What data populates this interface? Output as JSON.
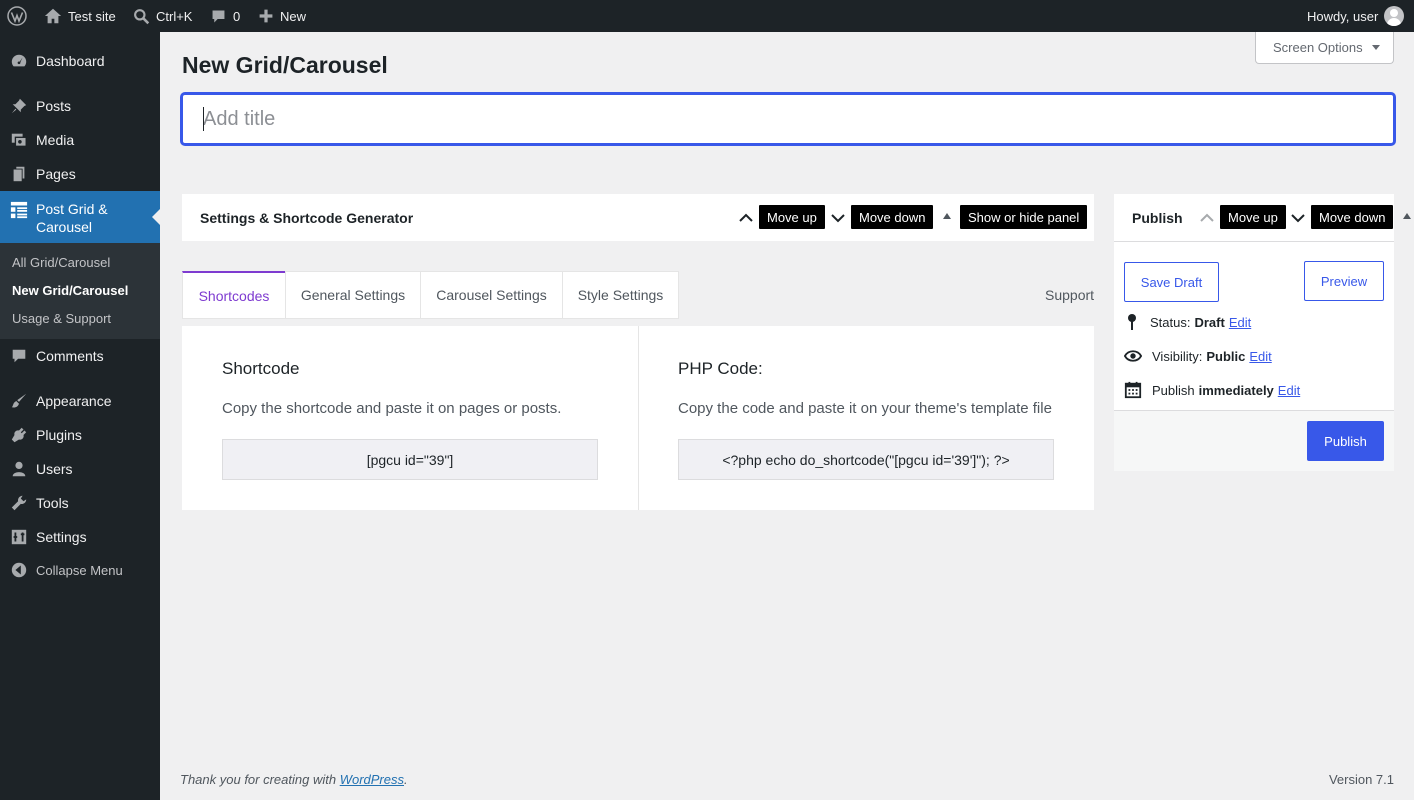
{
  "adminbar": {
    "site_name": "Test site",
    "search_shortcut": "Ctrl+K",
    "comments_count": "0",
    "new_label": "New",
    "howdy": "Howdy, user"
  },
  "sidebar": {
    "items": [
      {
        "label": "Dashboard",
        "icon": "dashboard-icon"
      },
      {
        "label": "Posts",
        "icon": "pin-icon"
      },
      {
        "label": "Media",
        "icon": "media-icon"
      },
      {
        "label": "Pages",
        "icon": "pages-icon"
      },
      {
        "label": "Post Grid &\nCarousel",
        "icon": "grid-icon"
      },
      {
        "label": "Comments",
        "icon": "comment-icon"
      },
      {
        "label": "Appearance",
        "icon": "brush-icon"
      },
      {
        "label": "Plugins",
        "icon": "plugin-icon"
      },
      {
        "label": "Users",
        "icon": "user-icon"
      },
      {
        "label": "Tools",
        "icon": "wrench-icon"
      },
      {
        "label": "Settings",
        "icon": "settings-icon"
      }
    ],
    "submenu": [
      "All Grid/Carousel",
      "New Grid/Carousel",
      "Usage & Support"
    ],
    "collapse_label": "Collapse Menu"
  },
  "screen_options": "Screen Options",
  "page_title": "New Grid/Carousel",
  "title_input": {
    "placeholder": "Add title",
    "value": ""
  },
  "settings_box": {
    "title": "Settings & Shortcode Generator",
    "move_up": "Move up",
    "move_down": "Move down",
    "toggle": "Show or hide panel"
  },
  "tabs": [
    "Shortcodes",
    "General Settings",
    "Carousel Settings",
    "Style Settings"
  ],
  "active_tab": "Shortcodes",
  "support_label": "Support",
  "shortcode": {
    "title": "Shortcode",
    "desc": "Copy the shortcode and paste it on pages or posts.",
    "code": "[pgcu id=\"39\"]"
  },
  "php": {
    "title": "PHP Code:",
    "desc": "Copy the code and paste it on your theme's template file",
    "code": "<?php echo do_shortcode(\"[pgcu id='39']\"); ?>"
  },
  "publish_box": {
    "title": "Publish",
    "move_up": "Move up",
    "move_down": "Move down",
    "save_draft": "Save Draft",
    "preview": "Preview",
    "status_label": "Status:",
    "status_value": "Draft",
    "visibility_label": "Visibility:",
    "visibility_value": "Public",
    "publish_label": "Publish",
    "publish_value": "immediately",
    "edit": "Edit",
    "publish_button": "Publish"
  },
  "footer": {
    "thanks_prefix": "Thank you for creating with ",
    "wordpress_link": "WordPress",
    "thanks_suffix": ".",
    "version": "Version 7.1"
  },
  "colors": {
    "accent": "#3858e9",
    "tab_active": "#7e3bd0",
    "sidebar": "#1d2327",
    "menu_current": "#2271b1"
  }
}
